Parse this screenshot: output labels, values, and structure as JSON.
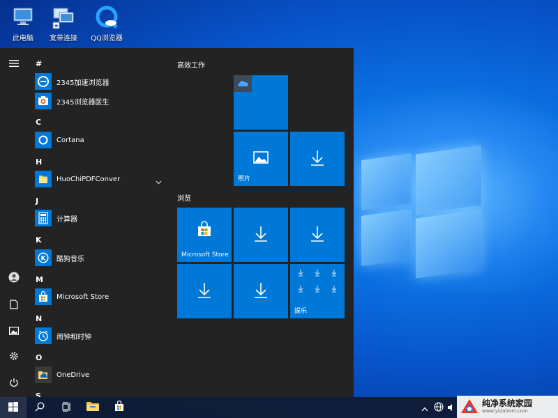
{
  "desktop": {
    "icons": [
      {
        "label": "此电脑",
        "icon": "computer-icon"
      },
      {
        "label": "宽带连接",
        "icon": "network-icon"
      },
      {
        "label": "QQ浏览器",
        "icon": "qq-browser-icon"
      }
    ]
  },
  "start_menu": {
    "rail": [
      {
        "icon": "hamburger-menu-icon"
      },
      {
        "icon": "user-account-icon"
      },
      {
        "icon": "documents-icon"
      },
      {
        "icon": "pictures-icon"
      },
      {
        "icon": "settings-icon"
      },
      {
        "icon": "power-icon"
      }
    ],
    "groups": [
      {
        "letter": "#",
        "apps": [
          {
            "name": "2345加速浏览器",
            "icon": "browser-2345-icon"
          },
          {
            "name": "2345浏览器医生",
            "icon": "browser-doctor-icon"
          }
        ]
      },
      {
        "letter": "C",
        "apps": [
          {
            "name": "Cortana",
            "icon": "cortana-icon"
          }
        ]
      },
      {
        "letter": "H",
        "apps": [
          {
            "name": "HuoChiPDFConver",
            "icon": "folder-icon",
            "expandable": true
          }
        ]
      },
      {
        "letter": "J",
        "apps": [
          {
            "name": "计算器",
            "icon": "calculator-icon"
          }
        ]
      },
      {
        "letter": "K",
        "apps": [
          {
            "name": "酷狗音乐",
            "icon": "kugou-icon"
          }
        ]
      },
      {
        "letter": "M",
        "apps": [
          {
            "name": "Microsoft Store",
            "icon": "store-icon"
          }
        ]
      },
      {
        "letter": "N",
        "apps": [
          {
            "name": "闹钟和时钟",
            "icon": "alarm-clock-icon"
          }
        ]
      },
      {
        "letter": "O",
        "apps": [
          {
            "name": "OneDrive",
            "icon": "onedrive-folder-icon"
          }
        ]
      },
      {
        "letter": "S",
        "apps": []
      }
    ],
    "sections": [
      {
        "title": "高效工作"
      },
      {
        "title": "浏览"
      }
    ],
    "tiles": {
      "photos_label": "照片",
      "store_label": "Microsoft Store",
      "entertainment_label": "娱乐"
    }
  },
  "taskbar": {
    "buttons": [
      {
        "icon": "windows-start-icon"
      },
      {
        "icon": "search-icon"
      },
      {
        "icon": "task-view-icon"
      },
      {
        "icon": "file-explorer-icon"
      },
      {
        "icon": "store-bag-icon"
      }
    ],
    "tray": [
      {
        "icon": "chevron-up-icon"
      },
      {
        "icon": "globe-icon"
      },
      {
        "icon": "speaker-icon"
      }
    ]
  },
  "watermark": {
    "name": "纯净系统家园",
    "url": "www.yidaimei.com"
  },
  "colors": {
    "tile_blue": "#0078d7",
    "menu_bg": "#232323",
    "taskbar_bg": "#101a30"
  }
}
